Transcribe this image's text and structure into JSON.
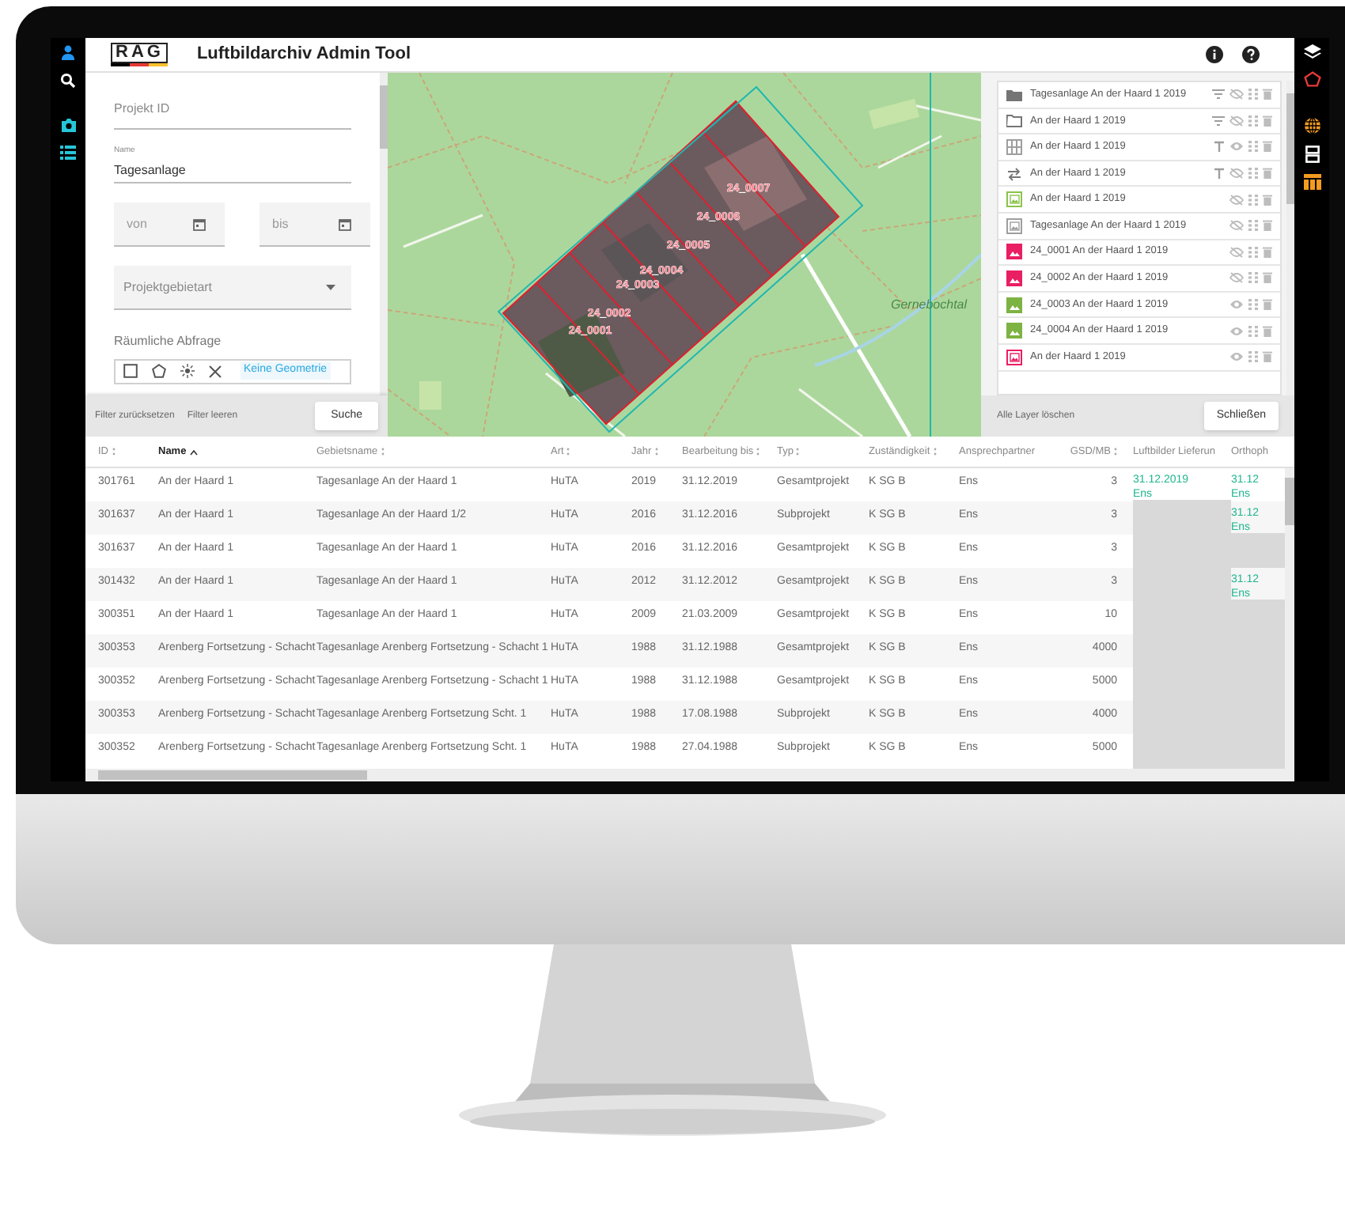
{
  "app": {
    "logo": "RAG",
    "title": "Luftbildarchiv Admin Tool"
  },
  "filter": {
    "project_id": {
      "placeholder": "Projekt ID"
    },
    "name": {
      "label": "Name",
      "value": "Tagesanlage"
    },
    "date_from": {
      "placeholder": "von"
    },
    "date_to": {
      "placeholder": "bis"
    },
    "area_type": {
      "placeholder": "Projektgebietart"
    },
    "spatial_label": "Räumliche Abfrage",
    "geometry_status": "Keine Geometrie",
    "links": [
      "Filter zurücksetzen",
      "Filter leeren"
    ],
    "search_button": "Suche"
  },
  "map": {
    "tiles": [
      "24_0001",
      "24_0002",
      "24_0003",
      "24_0004",
      "24_0005",
      "24_0006",
      "24_0007"
    ],
    "place_label": "Gernebochtal"
  },
  "layers": {
    "items": [
      {
        "kind": "folder",
        "color": "#757575",
        "label": "Tagesanlage An der Haard 1 2019",
        "tool": {
          "kind": "filter"
        },
        "visible": false
      },
      {
        "kind": "folder-outline",
        "color": "#757575",
        "label": "An der Haard 1 2019",
        "tool": {
          "kind": "filter"
        },
        "visible": false
      },
      {
        "kind": "grid",
        "color": "#9e9e9e",
        "label": "An der Haard 1 2019",
        "tool": {
          "kind": "text"
        },
        "visible": true
      },
      {
        "kind": "arrows",
        "color": "#757575",
        "label": "An der Haard 1 2019",
        "tool": {
          "kind": "text"
        },
        "visible": false
      },
      {
        "kind": "image-outline",
        "color": "#8bc34a",
        "label": "An der Haard 1 2019",
        "visible": false
      },
      {
        "kind": "image-outline",
        "color": "#9e9e9e",
        "label": "Tagesanlage An der Haard 1 2019",
        "visible": false
      },
      {
        "kind": "image",
        "color": "#e91e63",
        "label": "24_0001 An der Haard 1 2019",
        "visible": false
      },
      {
        "kind": "image",
        "color": "#e91e63",
        "label": "24_0002 An der Haard 1 2019",
        "visible": false
      },
      {
        "kind": "image",
        "color": "#7cb342",
        "label": "24_0003 An der Haard 1 2019",
        "visible": true
      },
      {
        "kind": "image",
        "color": "#7cb342",
        "label": "24_0004 An der Haard 1 2019",
        "visible": true
      },
      {
        "kind": "image-outline",
        "color": "#e91e63",
        "label": "An der Haard 1 2019",
        "visible": true
      }
    ],
    "clear_all": "Alle Layer löschen",
    "close_button": "Schließen"
  },
  "table": {
    "columns": [
      {
        "label": "ID",
        "sortable": true,
        "sorted": false,
        "numeric": false
      },
      {
        "label": "Name",
        "sortable": true,
        "sorted": true,
        "numeric": false
      },
      {
        "label": "Gebietsname",
        "sortable": true,
        "sorted": false,
        "numeric": false
      },
      {
        "label": "Art",
        "sortable": true,
        "sorted": false,
        "numeric": false
      },
      {
        "label": "Jahr",
        "sortable": true,
        "sorted": false,
        "numeric": false
      },
      {
        "label": "Bearbeitung bis",
        "sortable": true,
        "sorted": false,
        "numeric": false
      },
      {
        "label": "Typ",
        "sortable": true,
        "sorted": false,
        "numeric": false
      },
      {
        "label": "Zuständigkeit",
        "sortable": true,
        "sorted": false,
        "numeric": false
      },
      {
        "label": "Ansprechpartner",
        "sortable": false,
        "sorted": false,
        "numeric": false
      },
      {
        "label": "GSD/MB",
        "sortable": true,
        "sorted": false,
        "numeric": true
      },
      {
        "label": "Luftbilder Lieferun",
        "sortable": false,
        "sorted": false,
        "numeric": false
      },
      {
        "label": "Orthoph",
        "sortable": false,
        "sorted": false,
        "numeric": false
      }
    ],
    "rows": [
      {
        "cells": [
          "301761",
          "An der Haard 1",
          "Tagesanlage An der Haard 1",
          "HuTA",
          "2019",
          "31.12.2019",
          "Gesamtprojekt",
          "K SG B",
          "Ens",
          "3"
        ],
        "delivery": {
          "date": "31.12.2019",
          "name": "Ens"
        },
        "orthophoto": {
          "date": "31.12",
          "name": "Ens"
        }
      },
      {
        "cells": [
          "301637",
          "An der Haard 1",
          "Tagesanlage An der Haard 1/2",
          "HuTA",
          "2016",
          "31.12.2016",
          "Subprojekt",
          "K SG B",
          "Ens",
          "3"
        ],
        "orthophoto": {
          "date": "31.12",
          "name": "Ens"
        }
      },
      {
        "cells": [
          "301637",
          "An der Haard 1",
          "Tagesanlage An der Haard 1",
          "HuTA",
          "2016",
          "31.12.2016",
          "Gesamtprojekt",
          "K SG B",
          "Ens",
          "3"
        ]
      },
      {
        "cells": [
          "301432",
          "An der Haard 1",
          "Tagesanlage An der Haard 1",
          "HuTA",
          "2012",
          "31.12.2012",
          "Gesamtprojekt",
          "K SG B",
          "Ens",
          "3"
        ],
        "orthophoto": {
          "date": "31.12",
          "name": "Ens"
        }
      },
      {
        "cells": [
          "300351",
          "An der Haard 1",
          "Tagesanlage An der Haard 1",
          "HuTA",
          "2009",
          "21.03.2009",
          "Gesamtprojekt",
          "K SG B",
          "Ens",
          "10"
        ]
      },
      {
        "cells": [
          "300353",
          "Arenberg Fortsetzung - Schacht",
          "Tagesanlage Arenberg Fortsetzung - Schacht 1",
          "HuTA",
          "1988",
          "31.12.1988",
          "Gesamtprojekt",
          "K SG B",
          "Ens",
          "4000"
        ]
      },
      {
        "cells": [
          "300352",
          "Arenberg Fortsetzung - Schacht",
          "Tagesanlage Arenberg Fortsetzung - Schacht 1",
          "HuTA",
          "1988",
          "31.12.1988",
          "Gesamtprojekt",
          "K SG B",
          "Ens",
          "5000"
        ]
      },
      {
        "cells": [
          "300353",
          "Arenberg Fortsetzung - Schacht",
          "Tagesanlage Arenberg Fortsetzung Scht. 1",
          "HuTA",
          "1988",
          "17.08.1988",
          "Subprojekt",
          "K SG B",
          "Ens",
          "4000"
        ]
      },
      {
        "cells": [
          "300352",
          "Arenberg Fortsetzung - Schacht",
          "Tagesanlage Arenberg Fortsetzung Scht. 1",
          "HuTA",
          "1988",
          "27.04.1988",
          "Subprojekt",
          "K SG B",
          "Ens",
          "5000"
        ]
      }
    ]
  }
}
